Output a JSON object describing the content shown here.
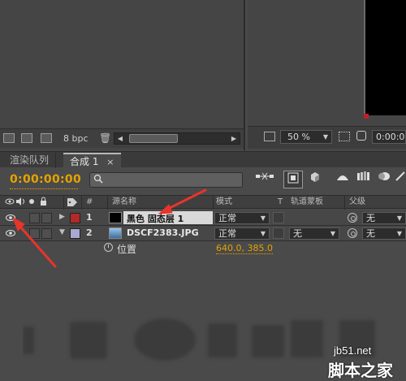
{
  "project_panel": {
    "bit_depth_label": "8 bpc"
  },
  "viewer": {
    "zoom_value": "50 %",
    "timecode": "0:00:00"
  },
  "tabs": [
    {
      "label": "渲染队列"
    },
    {
      "label": "合成 1",
      "close": "×"
    }
  ],
  "timeline": {
    "current_time": "0:00:00:00",
    "search_placeholder": ""
  },
  "columns": {
    "num": "#",
    "source_name": "源名称",
    "mode": "模式",
    "t": "T",
    "trkmat": "轨道蒙板",
    "parent": "父级"
  },
  "layers": [
    {
      "num": "1",
      "name": "黑色 固态层 1",
      "label_color": "#b02a2a",
      "thumb_color": "#000000",
      "mode": "正常",
      "trkmat": "",
      "parent": "无",
      "expanded": false
    },
    {
      "num": "2",
      "name": "DSCF2383.JPG",
      "label_color": "#a8a8d0",
      "thumb_color": "#5a8cc0",
      "mode": "正常",
      "trkmat": "无",
      "parent": "无",
      "expanded": true
    }
  ],
  "property": {
    "name": "位置",
    "value": "640.0, 385.0"
  },
  "watermark": {
    "site": "jb51.net",
    "brand": "脚本之家"
  },
  "colors": {
    "accent_timecode": "#e5a300",
    "annotation_arrow": "#e8342a"
  }
}
